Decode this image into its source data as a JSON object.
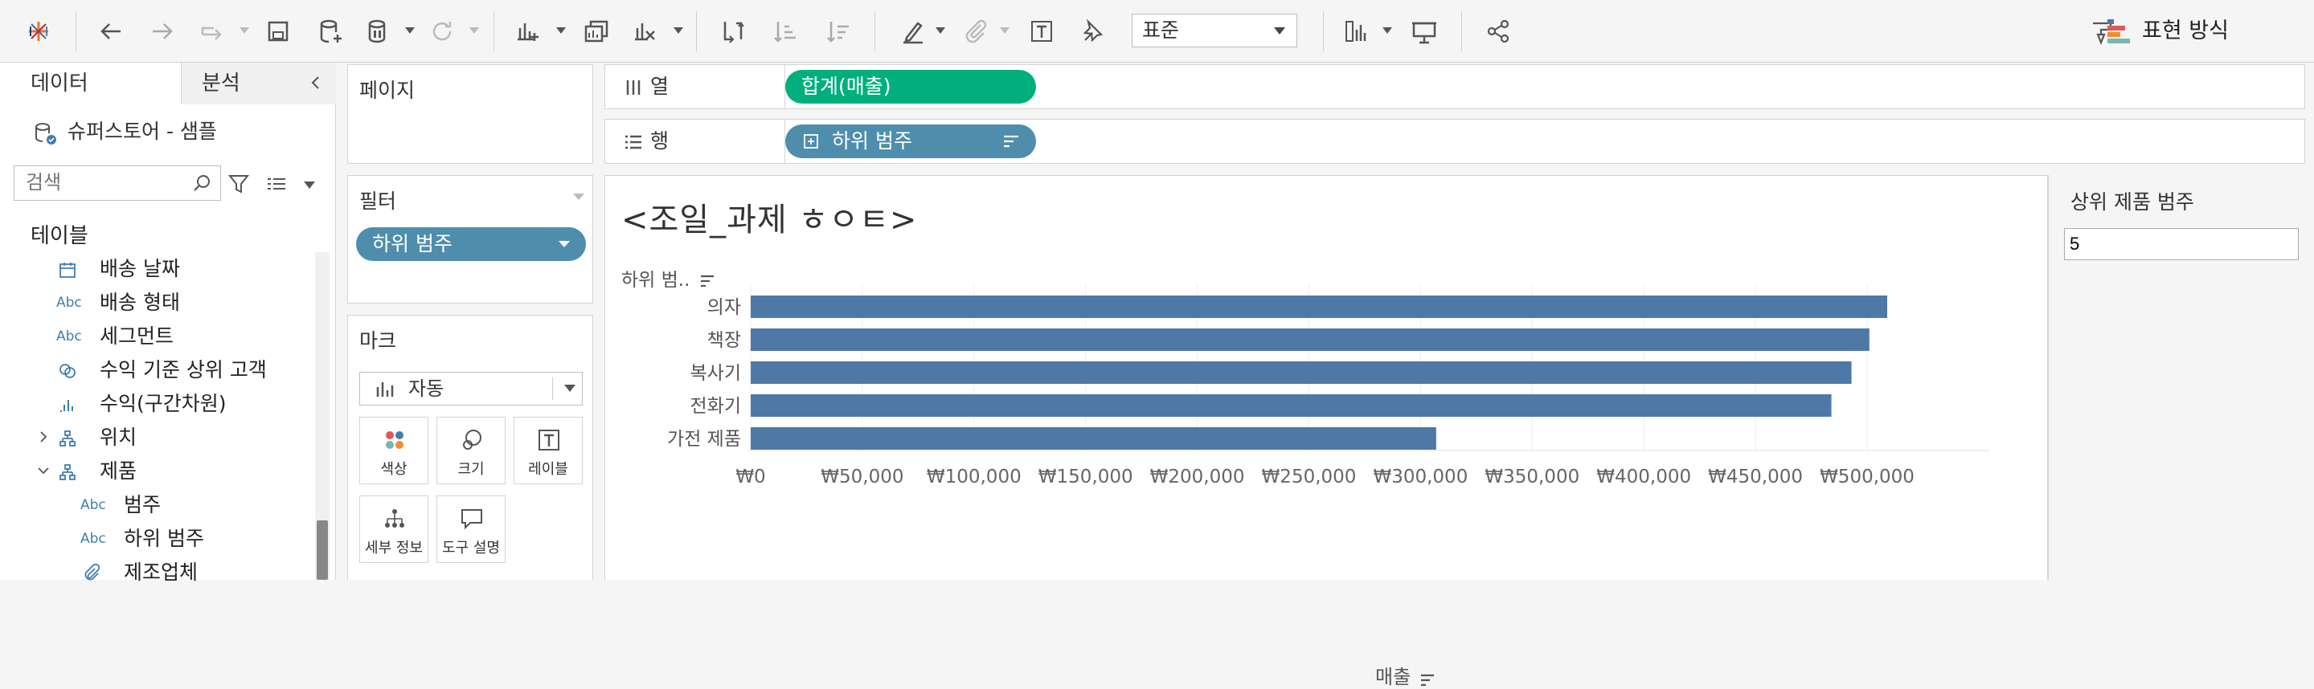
{
  "toolbar": {
    "standard_select": "표준",
    "show_me_label": "표현 방식",
    "icons": [
      "tableau-logo-icon",
      "back-icon",
      "forward-icon",
      "replay-icon",
      "save-icon",
      "new-datasource-icon",
      "pause-updates-icon",
      "refresh-icon",
      "new-worksheet-icon",
      "duplicate-sheet-icon",
      "clear-sheet-icon",
      "swap-icon",
      "sort-asc-icon",
      "sort-desc-icon",
      "highlight-icon",
      "group-icon",
      "labels-icon",
      "pin-icon",
      "fit-icon",
      "presentation-icon",
      "share-icon",
      "tooltip-icon",
      "show-me-icon"
    ]
  },
  "left_panel": {
    "tabs": [
      "데이터",
      "분석"
    ],
    "datasource": "슈퍼스토어 - 샘플",
    "search_placeholder": "검색",
    "section_title": "테이블",
    "fields": [
      {
        "label": "배송 날짜",
        "icon": "calendar-icon"
      },
      {
        "label": "배송 형태",
        "icon": "Abc"
      },
      {
        "label": "세그먼트",
        "icon": "Abc"
      },
      {
        "label": "수익 기준 상위 고객",
        "icon": "set-icon"
      },
      {
        "label": "수익(구간차원)",
        "icon": "bins-icon"
      },
      {
        "label": "위치",
        "icon": "hierarchy-icon"
      },
      {
        "label": "제품",
        "icon": "hierarchy-icon"
      },
      {
        "label": "범주",
        "icon": "Abc"
      },
      {
        "label": "하위 범주",
        "icon": "Abc"
      },
      {
        "label": "제조업체",
        "icon": "paperclip-icon"
      }
    ]
  },
  "cards": {
    "pages_title": "페이지",
    "filters_title": "필터",
    "filter_pill": "하위 범주",
    "marks_title": "마크",
    "marks_type": "자동",
    "mark_buttons": [
      "색상",
      "크기",
      "레이블",
      "세부 정보",
      "도구 설명"
    ]
  },
  "shelves": {
    "columns_label": "열",
    "columns_pill": "합계(매출)",
    "rows_label": "행",
    "rows_pill": "하위 범주"
  },
  "view": {
    "title": "<조일_과제 ㅎㅇㅌ>",
    "row_header": "하위 범..",
    "axis_title": "매출"
  },
  "parameter": {
    "title": "상위 제품 범주",
    "value": "5"
  },
  "colors": {
    "bar": "#4e79a7",
    "pill_blue": "#4e8eac",
    "pill_green": "#00af7c"
  },
  "chart_data": {
    "type": "bar",
    "orientation": "horizontal",
    "categories": [
      "의자",
      "책장",
      "복사기",
      "전화기",
      "가전 제품"
    ],
    "values": [
      509000,
      501000,
      493000,
      484000,
      307000
    ],
    "xlabel": "매출",
    "ylabel": "하위 범..",
    "xlim": [
      0,
      520000
    ],
    "ticks": [
      0,
      50000,
      100000,
      150000,
      200000,
      250000,
      300000,
      350000,
      400000,
      450000,
      500000
    ],
    "tick_labels": [
      "₩0",
      "₩50,000",
      "₩100,000",
      "₩150,000",
      "₩200,000",
      "₩250,000",
      "₩300,000",
      "₩350,000",
      "₩400,000",
      "₩450,000",
      "₩500,000"
    ],
    "grid": "vertical"
  }
}
